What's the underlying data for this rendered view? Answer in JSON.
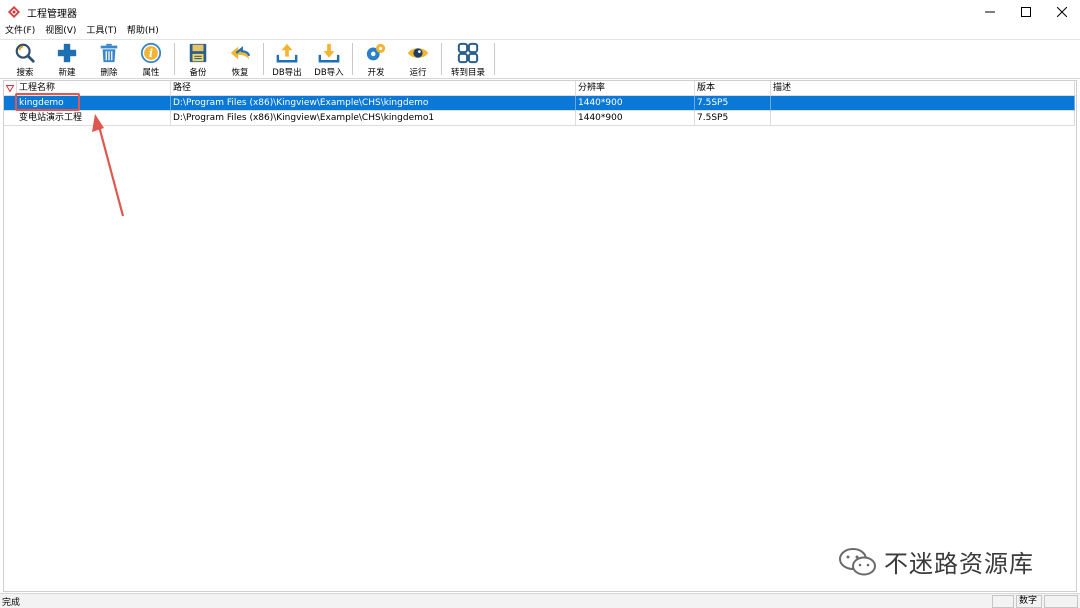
{
  "window": {
    "title": "工程管理器",
    "app_icon": "kingview-logo-icon",
    "controls": [
      "minimize-icon",
      "maximize-icon",
      "close-icon"
    ]
  },
  "menu": [
    {
      "label": "文件(F)"
    },
    {
      "label": "视图(V)"
    },
    {
      "label": "工具(T)"
    },
    {
      "label": "帮助(H)"
    }
  ],
  "toolbar": {
    "buttons": [
      {
        "label": "搜索",
        "icon": "search-icon"
      },
      {
        "label": "新建",
        "icon": "plus-icon"
      },
      {
        "label": "删除",
        "icon": "trash-icon"
      },
      {
        "label": "属性",
        "icon": "info-icon"
      },
      {
        "label": "备份",
        "icon": "save-icon"
      },
      {
        "label": "恢复",
        "icon": "undo-icon"
      },
      {
        "label": "DB导出",
        "icon": "db-export-icon"
      },
      {
        "label": "DB导入",
        "icon": "db-import-icon"
      },
      {
        "label": "开发",
        "icon": "gears-icon"
      },
      {
        "label": "运行",
        "icon": "eye-icon"
      },
      {
        "label": "转到目录",
        "icon": "grid-icon"
      }
    ]
  },
  "table": {
    "columns": [
      "工程名称",
      "路径",
      "分辨率",
      "版本",
      "描述"
    ],
    "rows": [
      {
        "name": "kingdemo",
        "path": "D:\\Program Files (x86)\\Kingview\\Example\\CHS\\kingdemo",
        "resolution": "1440*900",
        "version": "7.5SP5",
        "description": "",
        "selected": true
      },
      {
        "name": "变电站演示工程",
        "path": "D:\\Program Files (x86)\\Kingview\\Example\\CHS\\kingdemo1",
        "resolution": "1440*900",
        "version": "7.5SP5",
        "description": "",
        "selected": false
      }
    ]
  },
  "status": {
    "text": "完成",
    "panes": [
      "",
      "数字",
      ""
    ]
  },
  "watermark": {
    "text": "不迷路资源库",
    "icon": "wechat-icon"
  },
  "colors": {
    "selection": "#0a78d7",
    "annotation": "#e0574f"
  }
}
